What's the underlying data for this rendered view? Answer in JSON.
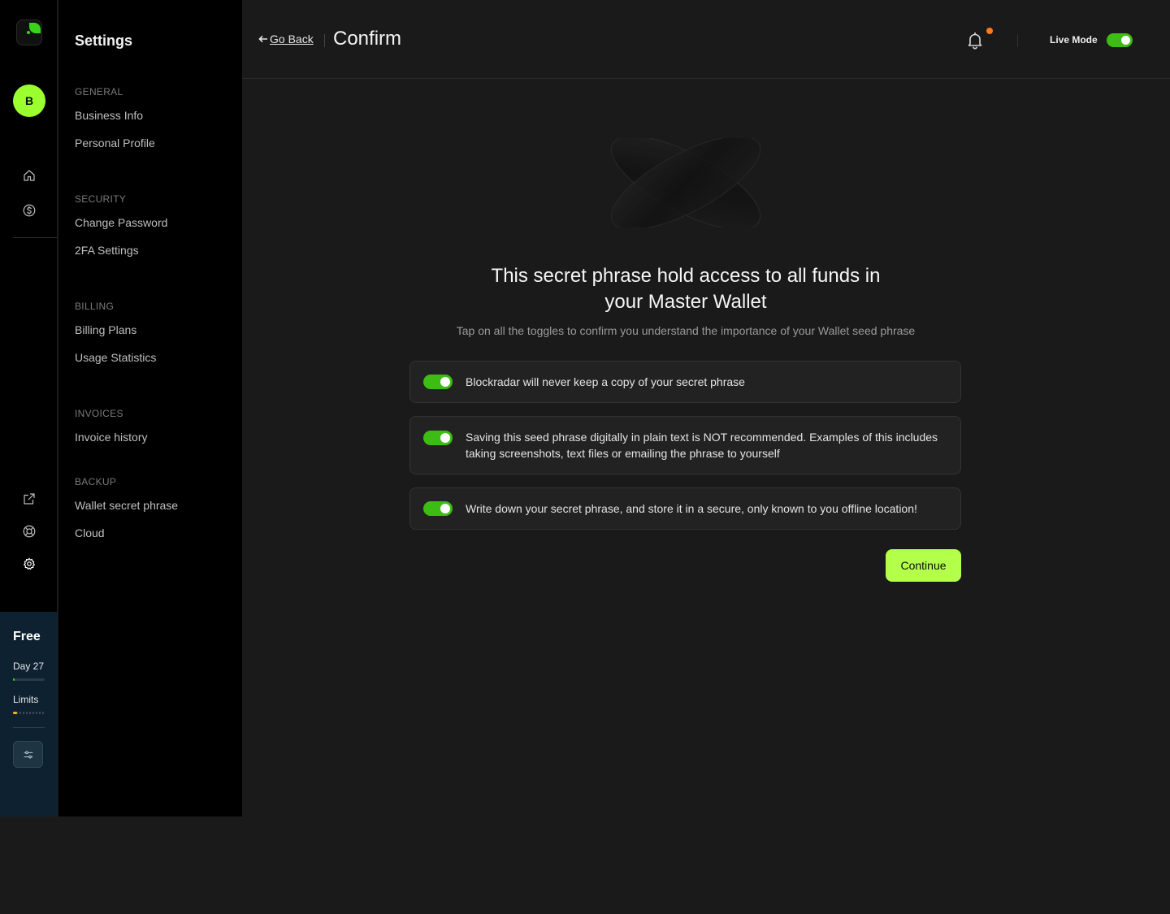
{
  "rail": {
    "avatar_initial": "B",
    "icons": [
      "home-icon",
      "dollar-icon",
      "external-link-icon",
      "support-icon",
      "gear-icon"
    ]
  },
  "plan": {
    "name": "Free",
    "day_label": "Day 27",
    "day_progress": 0.05,
    "limits_label": "Limits",
    "limits_progress": 0.12,
    "colors": {
      "day_bar": "#39d31a",
      "limits_bar": "#f6b61c"
    }
  },
  "sidebar": {
    "title": "Settings",
    "groups": [
      {
        "heading": "GENERAL",
        "items": [
          "Business Info",
          "Personal Profile"
        ]
      },
      {
        "heading": "SECURITY",
        "items": [
          "Change Password",
          "2FA Settings"
        ]
      },
      {
        "heading": "BILLING",
        "items": [
          "Billing Plans",
          "Usage Statistics"
        ]
      },
      {
        "heading": "INVOICES",
        "items": [
          "Invoice history"
        ]
      },
      {
        "heading": "BACKUP",
        "items": [
          "Wallet secret phrase",
          "Cloud"
        ]
      }
    ]
  },
  "header": {
    "back_label": "Go Back",
    "title": "Confirm",
    "live_mode_label": "Live Mode",
    "live_mode_on": true,
    "notification_badge": true
  },
  "main": {
    "heading_line1": "This secret phrase hold access to all funds in",
    "heading_line2": "your Master Wallet",
    "subtext": "Tap on all the toggles to confirm you understand the importance of your Wallet seed phrase",
    "confirmations": [
      {
        "text": "Blockradar will never keep a copy of your secret phrase",
        "checked": true
      },
      {
        "text": "Saving this seed phrase digitally in plain text is NOT recommended. Examples of this includes taking screenshots, text files or emailing the phrase to yourself",
        "checked": true
      },
      {
        "text": "Write down your secret phrase, and store it in a secure, only known to you offline location!",
        "checked": true
      }
    ],
    "continue_label": "Continue"
  },
  "colors": {
    "accent": "#b4ff4a",
    "toggle_on": "#3dbd14",
    "badge": "#ff7a1a",
    "plan_bg": "#0d2130"
  }
}
